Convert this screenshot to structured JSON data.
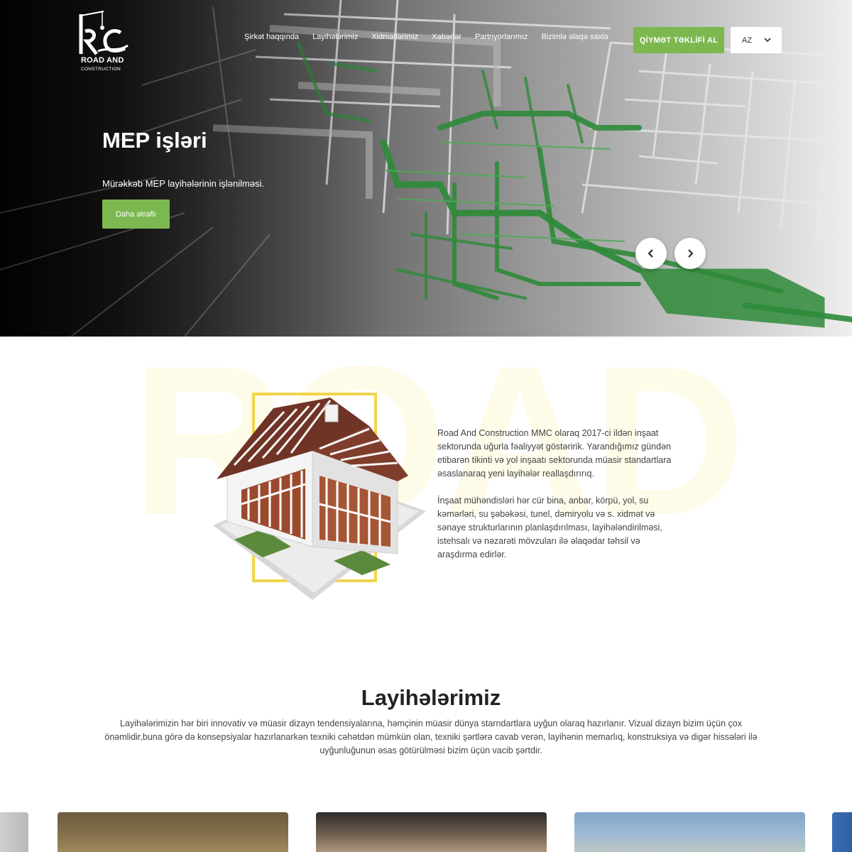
{
  "brand": {
    "logo_letters": "RC",
    "name_line1": "ROAD AND",
    "name_line2": "CONSTRUCTION"
  },
  "nav": {
    "items": [
      "Şirkət haqqında",
      "Layihələrimiz",
      "Xidmətlərimiz",
      "Xəbərlər",
      "Partnyorlarımız",
      "Bizimlə əlaqə saxla"
    ],
    "quote_button": "QİYMƏT TƏKLİFİ AL",
    "language": "AZ"
  },
  "hero": {
    "title": "MEP işləri",
    "subtitle": "Mürəkkəb MEP layihələrinin işlənilməsi.",
    "button": "Daha ətraflı",
    "prev_icon": "chevron-left-icon",
    "next_icon": "chevron-right-icon"
  },
  "about": {
    "watermark": "ROAD",
    "paragraph1": "Road And Construction MMC olaraq 2017-ci ildən inşaat sektorunda uğurla fəaliyyət göstəririk. Yarandığımız gündən etibarən tikinti və yol inşaatı sektorunda müasir standartlara əsaslanaraq yeni layihələr reallaşdırırıq.",
    "paragraph2": "İnşaat mühəndisləri hər cür bina, anbar, körpü, yol, su kəmərləri, su şəbəkəsi, tunel, dəmiryolu və s. xidmət və sənaye strukturlarının planlaşdırılması, layihələndirilməsi, istehsalı və nəzarəti mövzuları ilə əlaqədar təhsil və araşdırma edirlər."
  },
  "projects": {
    "title": "Layihələrimiz",
    "description": "Layihələrimizin hər biri innovativ və müasir dizayn tendensiyalarına, həmçinin müasir dünya starndartlara uyğun olaraq hazırlanır. Vizual dizayn bizim üçün çox önəmlidir,buna görə də konsepsiyalar hazırlanarkən texniki cəhətdən mümkün olan, texniki şərtlərə cavab verən, layihənin memarlıq, konstruksiya və digər hissələri ilə uyğunluğunun əsas götürülməsi bizim üçün vacib şərtdir."
  },
  "colors": {
    "accent_green": "#7cb84f",
    "frame_yellow": "#f1d54c",
    "pipe_green": "#2f8a3a"
  }
}
